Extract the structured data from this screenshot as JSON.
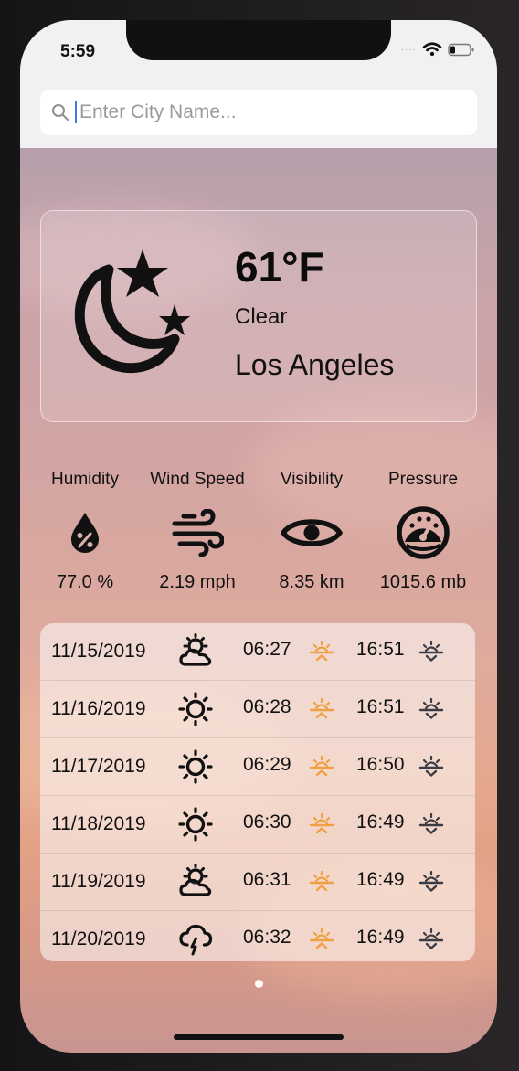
{
  "status_bar": {
    "time": "5:59"
  },
  "search": {
    "placeholder": "Enter City Name...",
    "value": ""
  },
  "current": {
    "temperature": "61°F",
    "condition": "Clear",
    "city": "Los Angeles",
    "icon": "moon-stars-icon"
  },
  "stats": [
    {
      "label": "Humidity",
      "value": "77.0 %",
      "icon": "humidity-drop-icon"
    },
    {
      "label": "Wind Speed",
      "value": "2.19 mph",
      "icon": "wind-icon"
    },
    {
      "label": "Visibility",
      "value": "8.35 km",
      "icon": "eye-icon"
    },
    {
      "label": "Pressure",
      "value": "1015.6 mb",
      "icon": "gauge-icon"
    }
  ],
  "forecast": [
    {
      "date": "11/15/2019",
      "icon": "partly-cloudy-icon",
      "sunrise": "06:27",
      "sunset": "16:51"
    },
    {
      "date": "11/16/2019",
      "icon": "sun-icon",
      "sunrise": "06:28",
      "sunset": "16:51"
    },
    {
      "date": "11/17/2019",
      "icon": "sun-icon",
      "sunrise": "06:29",
      "sunset": "16:50"
    },
    {
      "date": "11/18/2019",
      "icon": "sun-icon",
      "sunrise": "06:30",
      "sunset": "16:49"
    },
    {
      "date": "11/19/2019",
      "icon": "partly-cloudy-icon",
      "sunrise": "06:31",
      "sunset": "16:49"
    },
    {
      "date": "11/20/2019",
      "icon": "rain-cloud-icon",
      "sunrise": "06:32",
      "sunset": "16:49"
    }
  ],
  "colors": {
    "sunrise_accent": "#f0a040",
    "sunset_accent": "#3b3b45",
    "search_caret": "#3a7bf5"
  },
  "pagination": {
    "page": 1,
    "pages": 1
  }
}
